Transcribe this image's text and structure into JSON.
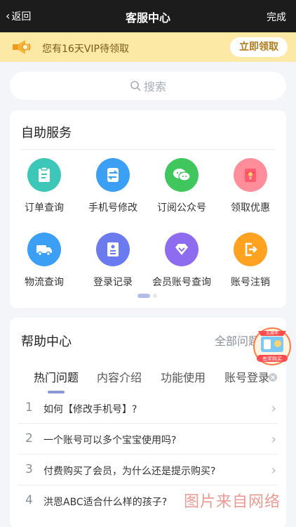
{
  "topbar": {
    "back_label": "返回",
    "title": "客服中心",
    "done_label": "完成"
  },
  "vip": {
    "text": "您有16天VIP待领取",
    "button": "立即领取"
  },
  "search": {
    "placeholder": "搜索"
  },
  "self_service": {
    "title": "自助服务",
    "items": [
      {
        "label": "订单查询",
        "icon": "clipboard-icon",
        "color": "#3cc7b8"
      },
      {
        "label": "手机号修改",
        "icon": "swap-arrows-icon",
        "color": "#3a9ff5"
      },
      {
        "label": "订阅公众号",
        "icon": "wechat-icon",
        "color": "#3fc65c"
      },
      {
        "label": "领取优惠",
        "icon": "red-packet-icon",
        "color": "#ff6b7c"
      },
      {
        "label": "物流查询",
        "icon": "truck-icon",
        "color": "#3a9ff5"
      },
      {
        "label": "登录记录",
        "icon": "id-card-icon",
        "color": "#6c7af0"
      },
      {
        "label": "会员账号查询",
        "icon": "diamond-icon",
        "color": "#8d6cf0"
      },
      {
        "label": "账号注销",
        "icon": "exit-icon",
        "color": "#ffa21f"
      }
    ]
  },
  "help": {
    "title": "帮助中心",
    "all_label": "全部问题",
    "tabs": [
      "热门问题",
      "内容介绍",
      "功能使用",
      "账号登录"
    ],
    "active_tab": 0,
    "questions": [
      {
        "num": "1",
        "text": "如何【修改手机号】?"
      },
      {
        "num": "2",
        "text": "一个账号可以多个宝宝使用吗?"
      },
      {
        "num": "3",
        "text": "付费购买了会员，为什么还是提示购买?"
      },
      {
        "num": "4",
        "text": "洪恩ABC适合什么样的孩子?"
      }
    ]
  },
  "floating_badge": {
    "top_text": "五周年",
    "bottom_text": "有奖购买"
  },
  "watermark": "图片来自网络"
}
